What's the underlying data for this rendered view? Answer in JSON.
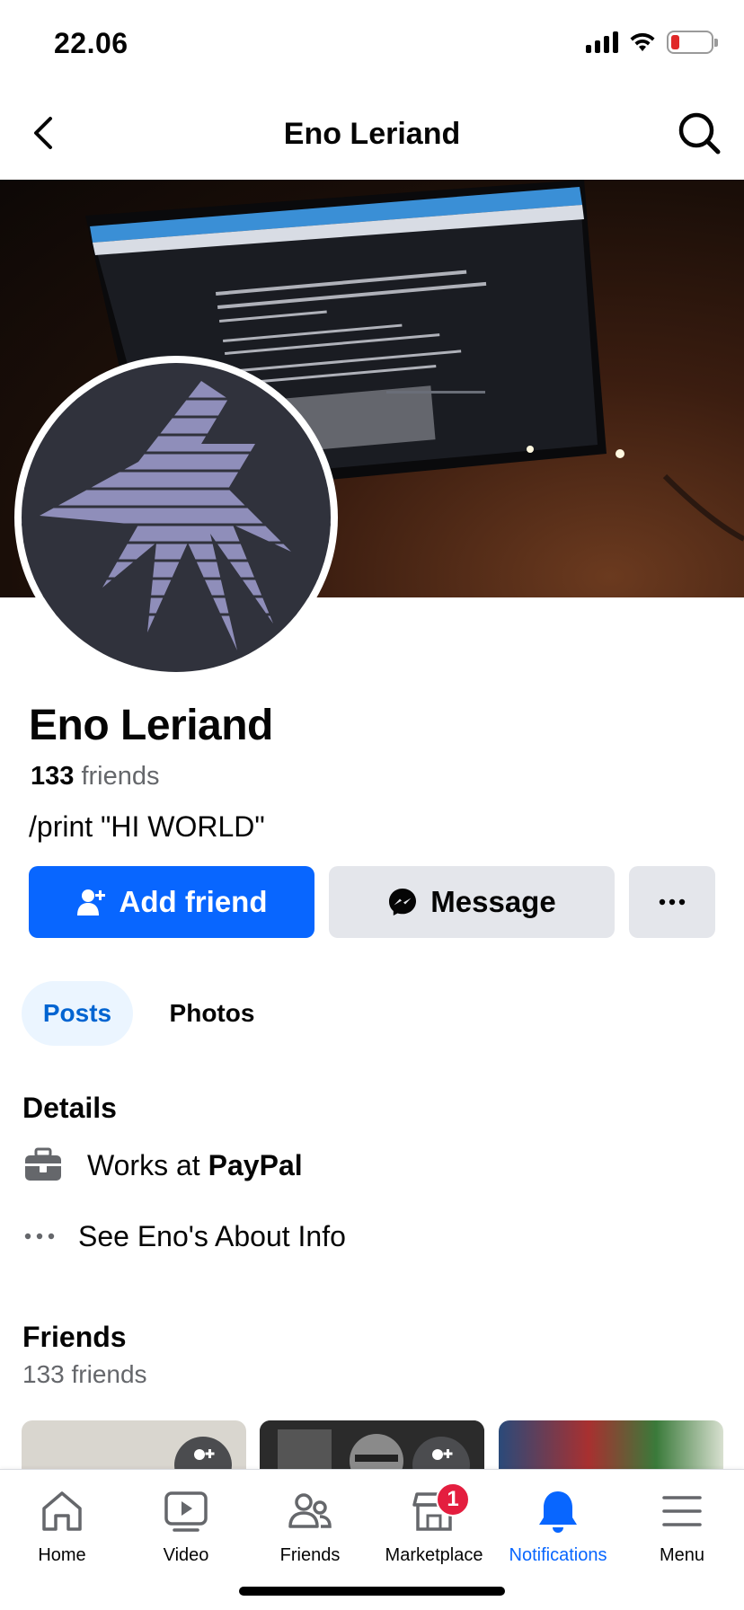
{
  "status_bar": {
    "time": "22.06"
  },
  "header": {
    "title": "Eno Leriand"
  },
  "profile": {
    "name": "Eno Leriand",
    "friend_count": "133",
    "friends_word": "friends",
    "bio": "/print \"HI WORLD\""
  },
  "actions": {
    "add_friend": "Add friend",
    "message": "Message"
  },
  "tabs": [
    {
      "label": "Posts",
      "active": true
    },
    {
      "label": "Photos",
      "active": false
    }
  ],
  "details": {
    "title": "Details",
    "work_prefix": "Works at",
    "work_company": "PayPal",
    "about": "See Eno's About Info"
  },
  "friends": {
    "title": "Friends",
    "count_label": "133 friends"
  },
  "bottom_nav": [
    {
      "label": "Home",
      "icon": "home-icon"
    },
    {
      "label": "Video",
      "icon": "video-icon"
    },
    {
      "label": "Friends",
      "icon": "friends-icon"
    },
    {
      "label": "Marketplace",
      "icon": "marketplace-icon",
      "badge": "1"
    },
    {
      "label": "Notifications",
      "icon": "bell-icon",
      "active": true
    },
    {
      "label": "Menu",
      "icon": "menu-icon"
    }
  ],
  "colors": {
    "primary": "#0866ff",
    "badge": "#e41e3f",
    "secondary_button": "#e4e6eb"
  }
}
